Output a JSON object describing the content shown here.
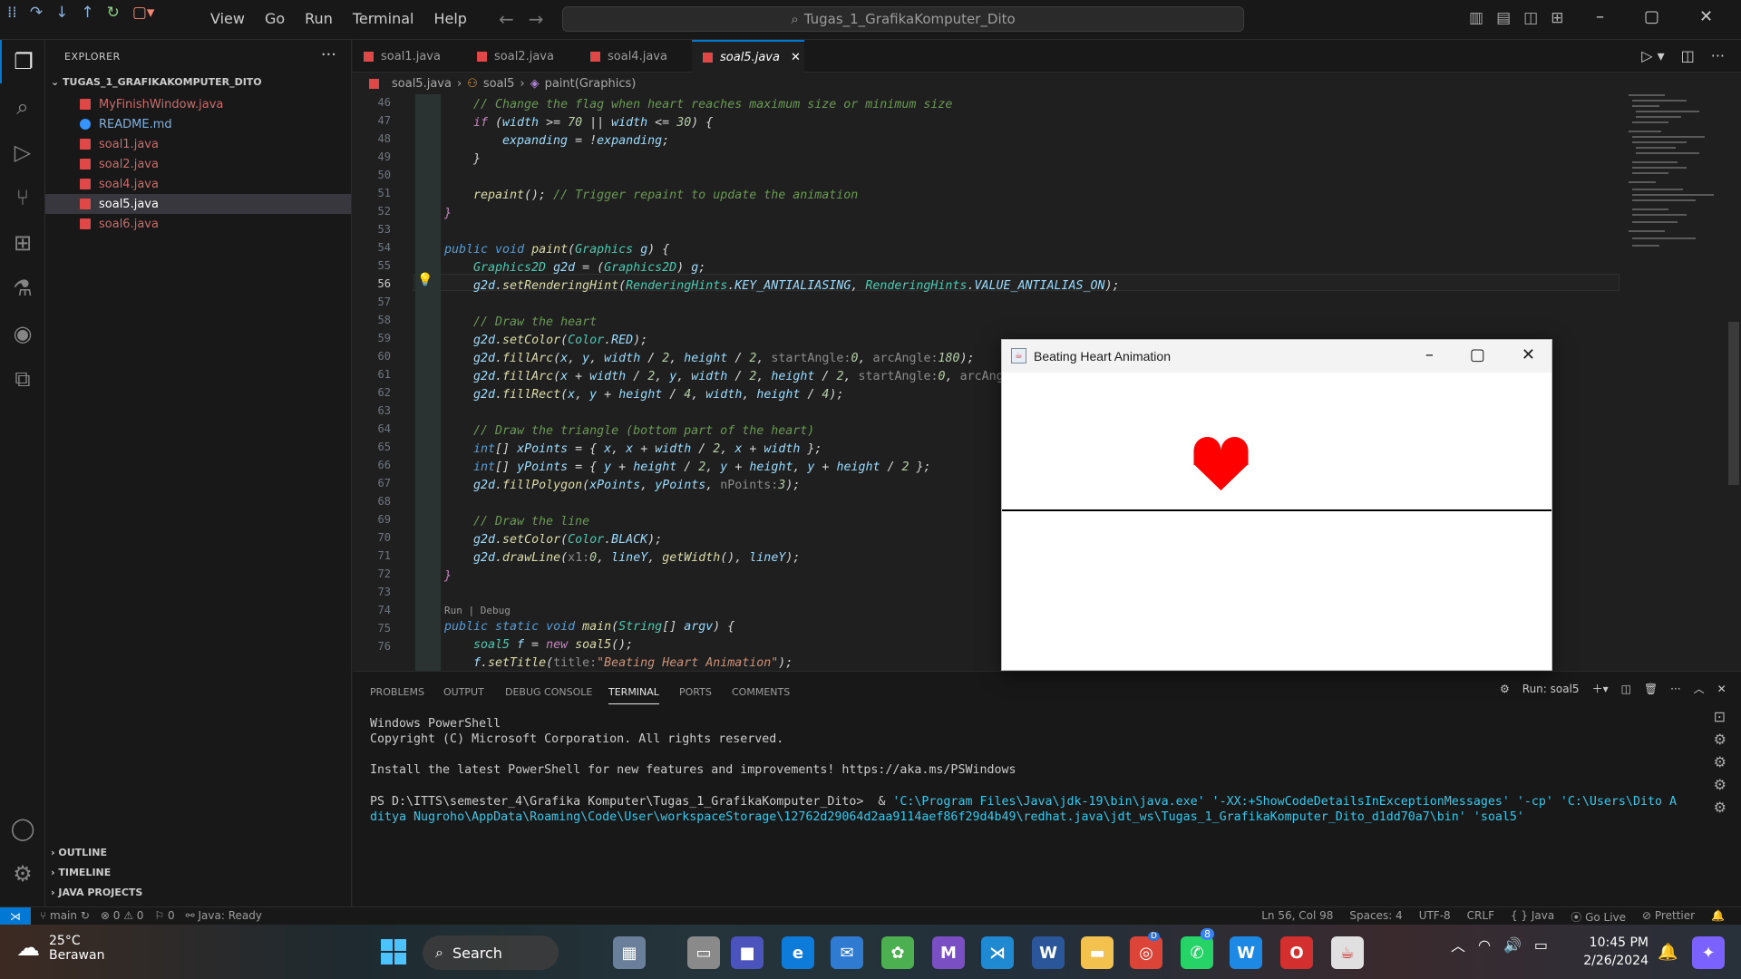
{
  "titlebar": {
    "menu": [
      "View",
      "Go",
      "Run",
      "Terminal",
      "Help"
    ],
    "command_center": "Tugas_1_GrafikaKomputer_Dito"
  },
  "sidebar": {
    "title": "EXPLORER",
    "more": "···",
    "folder": "TUGAS_1_GRAFIKAKOMPUTER_DITO",
    "files": [
      {
        "name": "MyFinishWindow.java",
        "type": "java"
      },
      {
        "name": "README.md",
        "type": "md"
      },
      {
        "name": "soal1.java",
        "type": "java"
      },
      {
        "name": "soal2.java",
        "type": "java"
      },
      {
        "name": "soal4.java",
        "type": "java"
      },
      {
        "name": "soal5.java",
        "type": "java",
        "selected": true
      },
      {
        "name": "soal6.java",
        "type": "java"
      }
    ],
    "sections": [
      "OUTLINE",
      "TIMELINE",
      "JAVA PROJECTS"
    ]
  },
  "tabs": [
    {
      "label": "soal1.java"
    },
    {
      "label": "soal2.java"
    },
    {
      "label": "soal4.java"
    },
    {
      "label": "soal5.java",
      "active": true
    }
  ],
  "breadcrumb": {
    "file": "soal5.java",
    "class": "soal5",
    "method": "paint(Graphics)",
    "sep": "›"
  },
  "editor": {
    "line_numbers": [
      "46",
      "47",
      "48",
      "49",
      "50",
      "51",
      "52",
      "53",
      "54",
      "55",
      "56",
      "57",
      "58",
      "59",
      "60",
      "61",
      "62",
      "63",
      "64",
      "65",
      "66",
      "67",
      "68",
      "69",
      "70",
      "71",
      "72",
      "73",
      "74",
      "75",
      "76"
    ],
    "codelens": "Run | Debug",
    "current_line": "56"
  },
  "panel": {
    "tabs": [
      "PROBLEMS",
      "OUTPUT",
      "DEBUG CONSOLE",
      "TERMINAL",
      "PORTS",
      "COMMENTS"
    ],
    "active": "TERMINAL",
    "run_label": "Run: soal5",
    "terminal": {
      "l1": "Windows PowerShell",
      "l2": "Copyright (C) Microsoft Corporation. All rights reserved.",
      "l3": "Install the latest PowerShell for new features and improvements! https://aka.ms/PSWindows",
      "prompt": "PS D:\\ITTS\\semester_4\\Grafika Komputer\\Tugas_1_GrafikaKomputer_Dito>  & ",
      "cmd1": "'C:\\Program Files\\Java\\jdk-19\\bin\\java.exe' '-XX:+ShowCodeDetailsInExceptionMessages' '-cp' 'C:\\Users\\Dito A",
      "cmd2": "ditya Nugroho\\AppData\\Roaming\\Code\\User\\workspaceStorage\\12762d29064d2aa9114aef86f29d4b49\\redhat.java\\jdt_ws\\Tugas_1_GrafikaKomputer_Dito_d1dd70a7\\bin' 'soal5'"
    }
  },
  "status": {
    "branch": "main",
    "errors": "⊗ 0 ⚠ 0",
    "ports": "⚐ 0",
    "java": "Java: Ready",
    "position": "Ln 56, Col 98",
    "spaces": "Spaces: 4",
    "encoding": "UTF-8",
    "eol": "CRLF",
    "language": "{ } Java",
    "golive": "Go Live",
    "prettier": "Prettier"
  },
  "java_window": {
    "title": "Beating Heart Animation",
    "heart_color": "#ff0000"
  },
  "taskbar": {
    "temp": "25°C",
    "weather": "Berawan",
    "search": "Search",
    "time": "10:45 PM",
    "date": "2/26/2024",
    "badge_whatsapp": "8",
    "badge_chrome": "D"
  }
}
